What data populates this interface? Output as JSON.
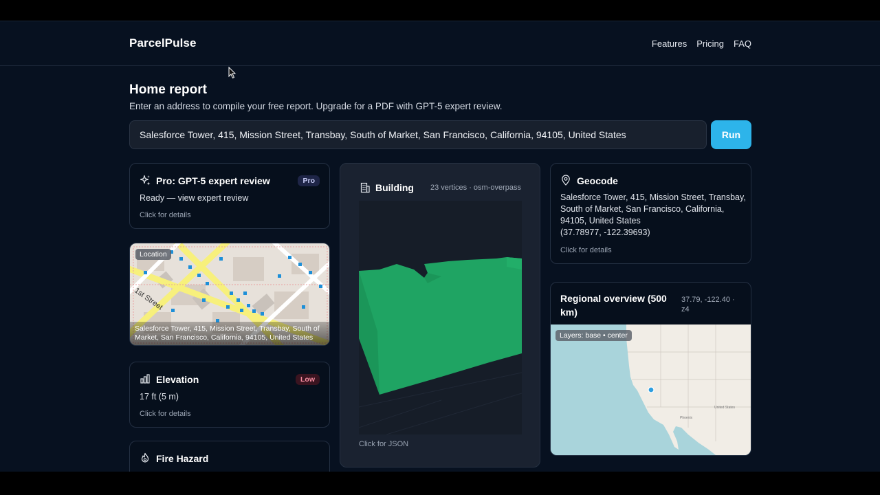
{
  "app": {
    "brand": "ParcelPulse"
  },
  "nav": {
    "features": "Features",
    "pricing": "Pricing",
    "faq": "FAQ"
  },
  "page": {
    "title": "Home report",
    "subtitle": "Enter an address to compile your free report. Upgrade for a PDF with GPT-5 expert review."
  },
  "search": {
    "value": "Salesforce Tower, 415, Mission Street, Transbay, South of Market, San Francisco, California, 94105, United States",
    "run_label": "Run"
  },
  "pro_card": {
    "title": "Pro: GPT-5 expert review",
    "badge": "Pro",
    "status": "Ready — view expert review",
    "hint": "Click for details"
  },
  "location_map": {
    "chip": "Location",
    "caption": "Salesforce Tower, 415, Mission Street, Transbay, South of Market, San Francisco, California, 94105, United States",
    "street_label": "1st Street"
  },
  "elevation_card": {
    "title": "Elevation",
    "badge": "Low",
    "value": "17 ft (5 m)",
    "hint": "Click for details"
  },
  "fire_card": {
    "title": "Fire Hazard"
  },
  "building_card": {
    "title": "Building",
    "meta": "23 vertices · osm-overpass",
    "hint": "Click for JSON"
  },
  "geocode_card": {
    "title": "Geocode",
    "address_line1": "Salesforce Tower, 415, Mission Street, Transbay,",
    "address_line2": "South of Market, San Francisco, California,",
    "address_line3": "94105, United States",
    "coords": "(37.78977, -122.39693)",
    "hint": "Click for details"
  },
  "regional_card": {
    "title_line1": "Regional overview (500",
    "title_line2": "km)",
    "meta_line1": "37.79, -122.40 ·",
    "meta_line2": "z4",
    "layers_chip": "Layers: base • center",
    "map_label_phoenix": "Phoenix",
    "map_label_us": "United States"
  },
  "colors": {
    "background": "#071120",
    "accent": "#2db4ea",
    "building_fill": "#1fa463",
    "pro_badge_bg": "#1e2547",
    "low_badge_bg": "#3a1420",
    "low_badge_text": "#f58ca0"
  }
}
